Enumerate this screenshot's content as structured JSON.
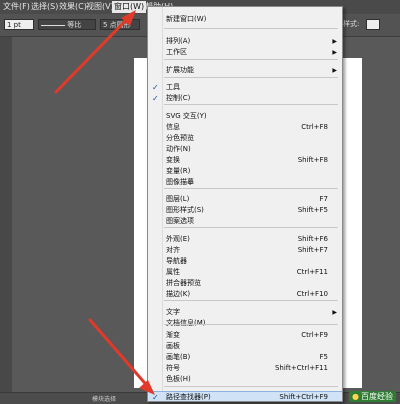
{
  "menubar": {
    "items": [
      "文件(F)",
      "选择(S)",
      "效果(C)",
      "视图(V)",
      "窗口(W)",
      "帮助(H)"
    ]
  },
  "options_bar": {
    "stroke_weight": "1 pt",
    "stroke_style": "等比",
    "brush": "5 点圆形",
    "style_label": "样式:"
  },
  "status_text": "模块选择",
  "watermark": "百度经验",
  "menu": {
    "items": [
      {
        "label": "新建窗口(W)",
        "shortcut": "",
        "checked": false,
        "submenu": false
      },
      {
        "label": "排列(A)",
        "shortcut": "",
        "checked": false,
        "submenu": true
      },
      {
        "label": "工作区",
        "shortcut": "",
        "checked": false,
        "submenu": true
      },
      {
        "label": "扩展功能",
        "shortcut": "",
        "checked": false,
        "submenu": true
      },
      {
        "label": "工具",
        "shortcut": "",
        "checked": true,
        "submenu": false
      },
      {
        "label": "控制(C)",
        "shortcut": "",
        "checked": true,
        "submenu": false
      },
      {
        "label": "SVG 交互(Y)",
        "shortcut": "",
        "checked": false,
        "submenu": false
      },
      {
        "label": "信息",
        "shortcut": "Ctrl+F8",
        "checked": false,
        "submenu": false
      },
      {
        "label": "分色预览",
        "shortcut": "",
        "checked": false,
        "submenu": false
      },
      {
        "label": "动作(N)",
        "shortcut": "",
        "checked": false,
        "submenu": false
      },
      {
        "label": "变换",
        "shortcut": "Shift+F8",
        "checked": false,
        "submenu": false
      },
      {
        "label": "变量(R)",
        "shortcut": "",
        "checked": false,
        "submenu": false
      },
      {
        "label": "图像描摹",
        "shortcut": "",
        "checked": false,
        "submenu": false
      },
      {
        "label": "图层(L)",
        "shortcut": "F7",
        "checked": false,
        "submenu": false
      },
      {
        "label": "图形样式(S)",
        "shortcut": "Shift+F5",
        "checked": false,
        "submenu": false
      },
      {
        "label": "图案选项",
        "shortcut": "",
        "checked": false,
        "submenu": false
      },
      {
        "label": "外观(E)",
        "shortcut": "Shift+F6",
        "checked": false,
        "submenu": false
      },
      {
        "label": "对齐",
        "shortcut": "Shift+F7",
        "checked": false,
        "submenu": false
      },
      {
        "label": "导航器",
        "shortcut": "",
        "checked": false,
        "submenu": false
      },
      {
        "label": "属性",
        "shortcut": "Ctrl+F11",
        "checked": false,
        "submenu": false
      },
      {
        "label": "拼合器预览",
        "shortcut": "",
        "checked": false,
        "submenu": false
      },
      {
        "label": "描边(K)",
        "shortcut": "Ctrl+F10",
        "checked": false,
        "submenu": false
      },
      {
        "label": "文字",
        "shortcut": "",
        "checked": false,
        "submenu": true
      },
      {
        "label": "文档信息(M)",
        "shortcut": "",
        "checked": false,
        "submenu": false
      },
      {
        "label": "渐变",
        "shortcut": "Ctrl+F9",
        "checked": false,
        "submenu": false
      },
      {
        "label": "画板",
        "shortcut": "",
        "checked": false,
        "submenu": false
      },
      {
        "label": "画笔(B)",
        "shortcut": "F5",
        "checked": false,
        "submenu": false
      },
      {
        "label": "符号",
        "shortcut": "Shift+Ctrl+F11",
        "checked": false,
        "submenu": false
      },
      {
        "label": "色板(H)",
        "shortcut": "",
        "checked": false,
        "submenu": false
      },
      {
        "label": "路径查找器(P)",
        "shortcut": "Shift+Ctrl+F9",
        "checked": true,
        "submenu": false
      }
    ]
  },
  "colors": {
    "accent_highlight": "#cfe2f6",
    "annotation_arrow": "#e03a2a",
    "menu_bg": "#f0f0f0",
    "workspace_bg": "#595959"
  }
}
